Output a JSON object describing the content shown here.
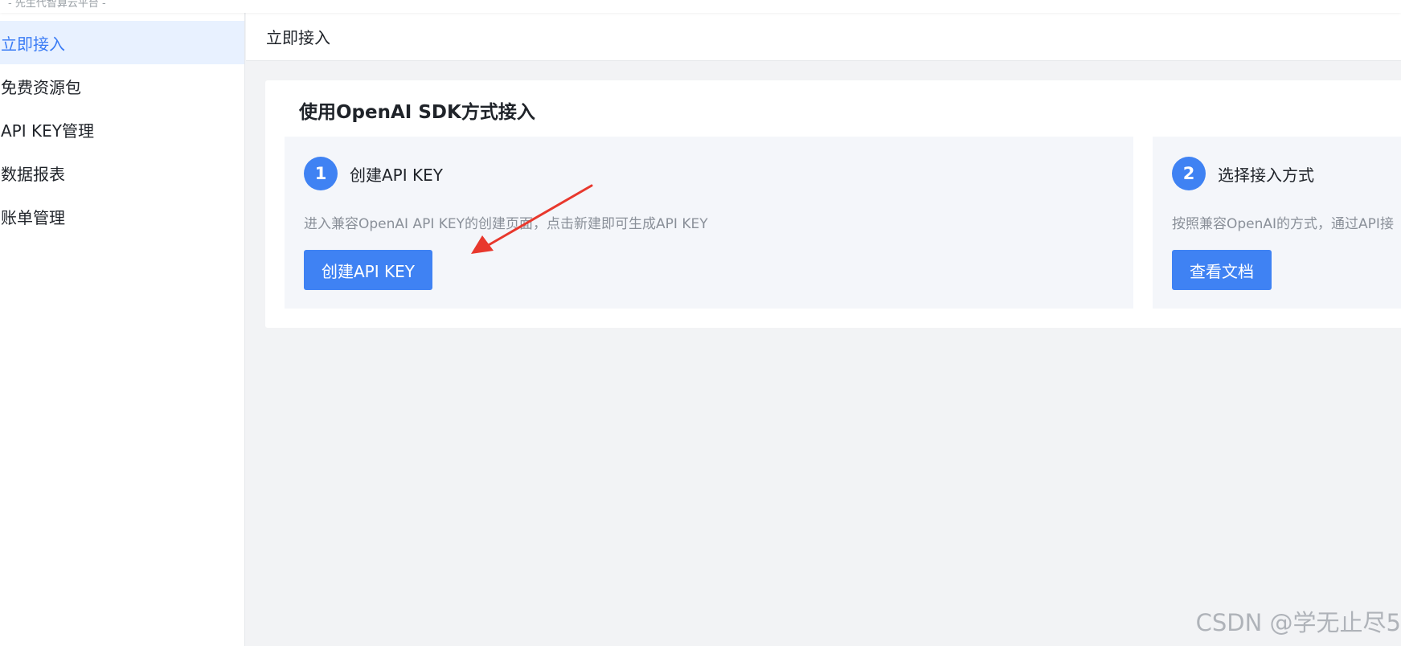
{
  "topbar": {
    "slogan": "- 先生代智算云平台 -"
  },
  "sidebar": {
    "items": [
      {
        "label": "立即接入",
        "active": true
      },
      {
        "label": "免费资源包"
      },
      {
        "label": "API KEY管理"
      },
      {
        "label": "数据报表"
      },
      {
        "label": "账单管理"
      }
    ]
  },
  "header": {
    "title": "立即接入"
  },
  "card": {
    "title": "使用OpenAI SDK方式接入",
    "steps": [
      {
        "number": "1",
        "heading": "创建API KEY",
        "description": "进入兼容OpenAI API KEY的创建页面，点击新建即可生成API KEY",
        "button_label": "创建API KEY"
      },
      {
        "number": "2",
        "heading": "选择接入方式",
        "description": "按照兼容OpenAI的方式，通过API接",
        "button_label": "查看文档"
      }
    ]
  },
  "annotation": {
    "arrow_color": "#e8382d",
    "arrow_icon": "red-arrow-icon"
  },
  "watermark": "CSDN @学无止尽5",
  "colors": {
    "primary": "#3f82f3",
    "active_nav_bg": "#e8f1ff",
    "active_nav_text": "#3b7cf5",
    "page_bg": "#f2f3f5",
    "step_bg": "#f4f6fa"
  }
}
